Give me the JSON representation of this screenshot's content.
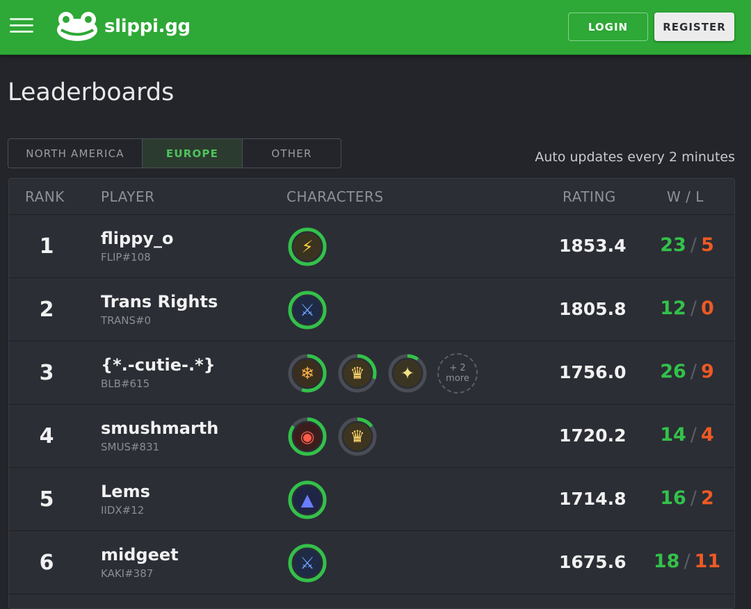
{
  "header": {
    "logo_text": "slippi.gg",
    "login_label": "LOGIN",
    "register_label": "REGISTER",
    "brand_color": "#2ea836"
  },
  "page": {
    "title": "Leaderboards",
    "auto_update_text": "Auto updates every 2 minutes"
  },
  "tabs": [
    {
      "label": "NORTH AMERICA",
      "active": false
    },
    {
      "label": "EUROPE",
      "active": true
    },
    {
      "label": "OTHER",
      "active": false
    }
  ],
  "table": {
    "columns": [
      "RANK",
      "PLAYER",
      "CHARACTERS",
      "RATING",
      "W / L"
    ],
    "rows": [
      {
        "rank": "1",
        "name": "flippy_o",
        "tag": "FLIP#108",
        "rating": "1853.4",
        "wins": "23",
        "losses": "5",
        "characters": [
          {
            "icon": "pikachu-icon",
            "usage": 1.0
          }
        ],
        "more": null
      },
      {
        "rank": "2",
        "name": "Trans Rights",
        "tag": "TRANS#0",
        "rating": "1805.8",
        "wins": "12",
        "losses": "0",
        "characters": [
          {
            "icon": "marth-icon",
            "usage": 1.0
          }
        ],
        "more": null
      },
      {
        "rank": "3",
        "name": "{*.-cutie-.*}",
        "tag": "BLB#615",
        "rating": "1756.0",
        "wins": "26",
        "losses": "9",
        "characters": [
          {
            "icon": "ice-climbers-icon",
            "usage": 0.55
          },
          {
            "icon": "peach-icon",
            "usage": 0.3
          },
          {
            "icon": "zelda-icon",
            "usage": 0.1
          }
        ],
        "more": {
          "count": "+ 2",
          "label": "more"
        }
      },
      {
        "rank": "4",
        "name": "smushmarth",
        "tag": "SMUS#831",
        "rating": "1720.2",
        "wins": "14",
        "losses": "4",
        "characters": [
          {
            "icon": "captain-falcon-icon",
            "usage": 0.85
          },
          {
            "icon": "peach-icon",
            "usage": 0.15
          }
        ],
        "more": null
      },
      {
        "rank": "5",
        "name": "Lems",
        "tag": "IIDX#12",
        "rating": "1714.8",
        "wins": "16",
        "losses": "2",
        "characters": [
          {
            "icon": "falco-icon",
            "usage": 1.0
          }
        ],
        "more": null
      },
      {
        "rank": "6",
        "name": "midgeet",
        "tag": "KAKI#387",
        "rating": "1675.6",
        "wins": "18",
        "losses": "11",
        "characters": [
          {
            "icon": "marth-icon",
            "usage": 1.0
          }
        ],
        "more": null
      }
    ]
  },
  "colors": {
    "win": "#33c14a",
    "loss": "#ee5a24",
    "ring_fill": "#33c14a",
    "ring_track": "#4a4d55"
  }
}
